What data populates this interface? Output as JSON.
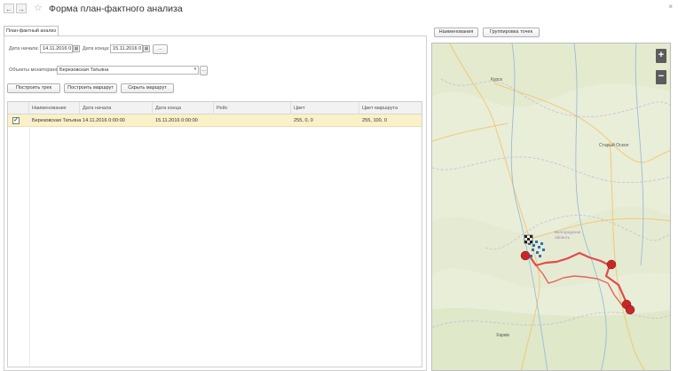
{
  "window": {
    "title": "Форма план-фактного анализа",
    "back": "←",
    "forward": "→",
    "star": "☆",
    "close": "×"
  },
  "left": {
    "tab": "План-фактный анализ",
    "start_label": "Дата начала:",
    "start_value": "14.11.2016  0",
    "end_label": "Дата конца:",
    "end_value": "15.11.2016  0",
    "more_btn": "...",
    "objects_label": "Объекты мониторинга:",
    "objects_value": "Березовская Татьяна",
    "build_track": "Построить трек",
    "build_route": "Построить маршрут",
    "hide_route": "Скрыть маршрут",
    "columns": [
      "Наименование",
      "Дата начала",
      "Дата конца",
      "Рейс",
      "Цвет",
      "Цвет маршрута"
    ],
    "rows": [
      {
        "checked": true,
        "name": "Березовская Татьяна",
        "start": "14.11.2016 0:00:00",
        "end": "15.11.2016 0:00:00",
        "trip": "",
        "color": "255, 0, 0",
        "route_color": "255, 100, 0"
      }
    ]
  },
  "right": {
    "names_btn": "Наименования",
    "group_btn": "Группировка точек",
    "zoom_in": "+",
    "zoom_out": "−",
    "map_labels": {
      "kursk": "Курск",
      "stary_oskol": "Старый Оскол",
      "belgorod_obl": "Белгородская область",
      "kharkiv": "Харків"
    }
  },
  "colors": {
    "selected_row": "#fbf1c8",
    "track": "#e04b4b",
    "marker": "#c62828",
    "points": "#2f6fb5"
  }
}
